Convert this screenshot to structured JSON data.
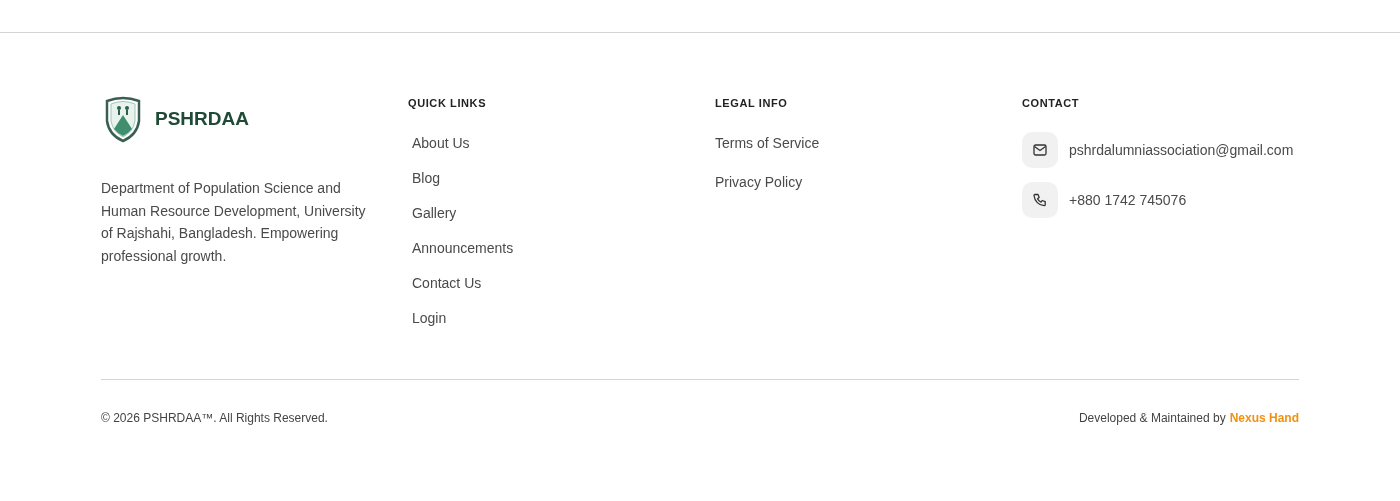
{
  "brand": {
    "name": "PSHRDAA",
    "description": "Department of Population Science and Human Resource Development, University of Rajshahi, Bangladesh. Empowering professional growth."
  },
  "columns": [
    {
      "kind": "links",
      "heading": "QUICK LINKS",
      "items": [
        "About Us",
        "Blog",
        "Gallery",
        "Announcements",
        "Contact Us",
        "Login"
      ]
    },
    {
      "kind": "links",
      "heading": "LEGAL INFO",
      "items": [
        "Terms of Service",
        "Privacy Policy"
      ]
    },
    {
      "kind": "contact",
      "heading": "CONTACT",
      "items": [
        {
          "kind": "email",
          "text": "pshrdalumniassociation@gmail.com"
        },
        {
          "kind": "phone",
          "text": "+880 1742 745076"
        }
      ]
    }
  ],
  "bottom": {
    "copyright": "© 2026 PSHRDAA™. All Rights Reserved.",
    "credit": "Developed & Maintained by",
    "credit_link": "Nexus Hand"
  }
}
